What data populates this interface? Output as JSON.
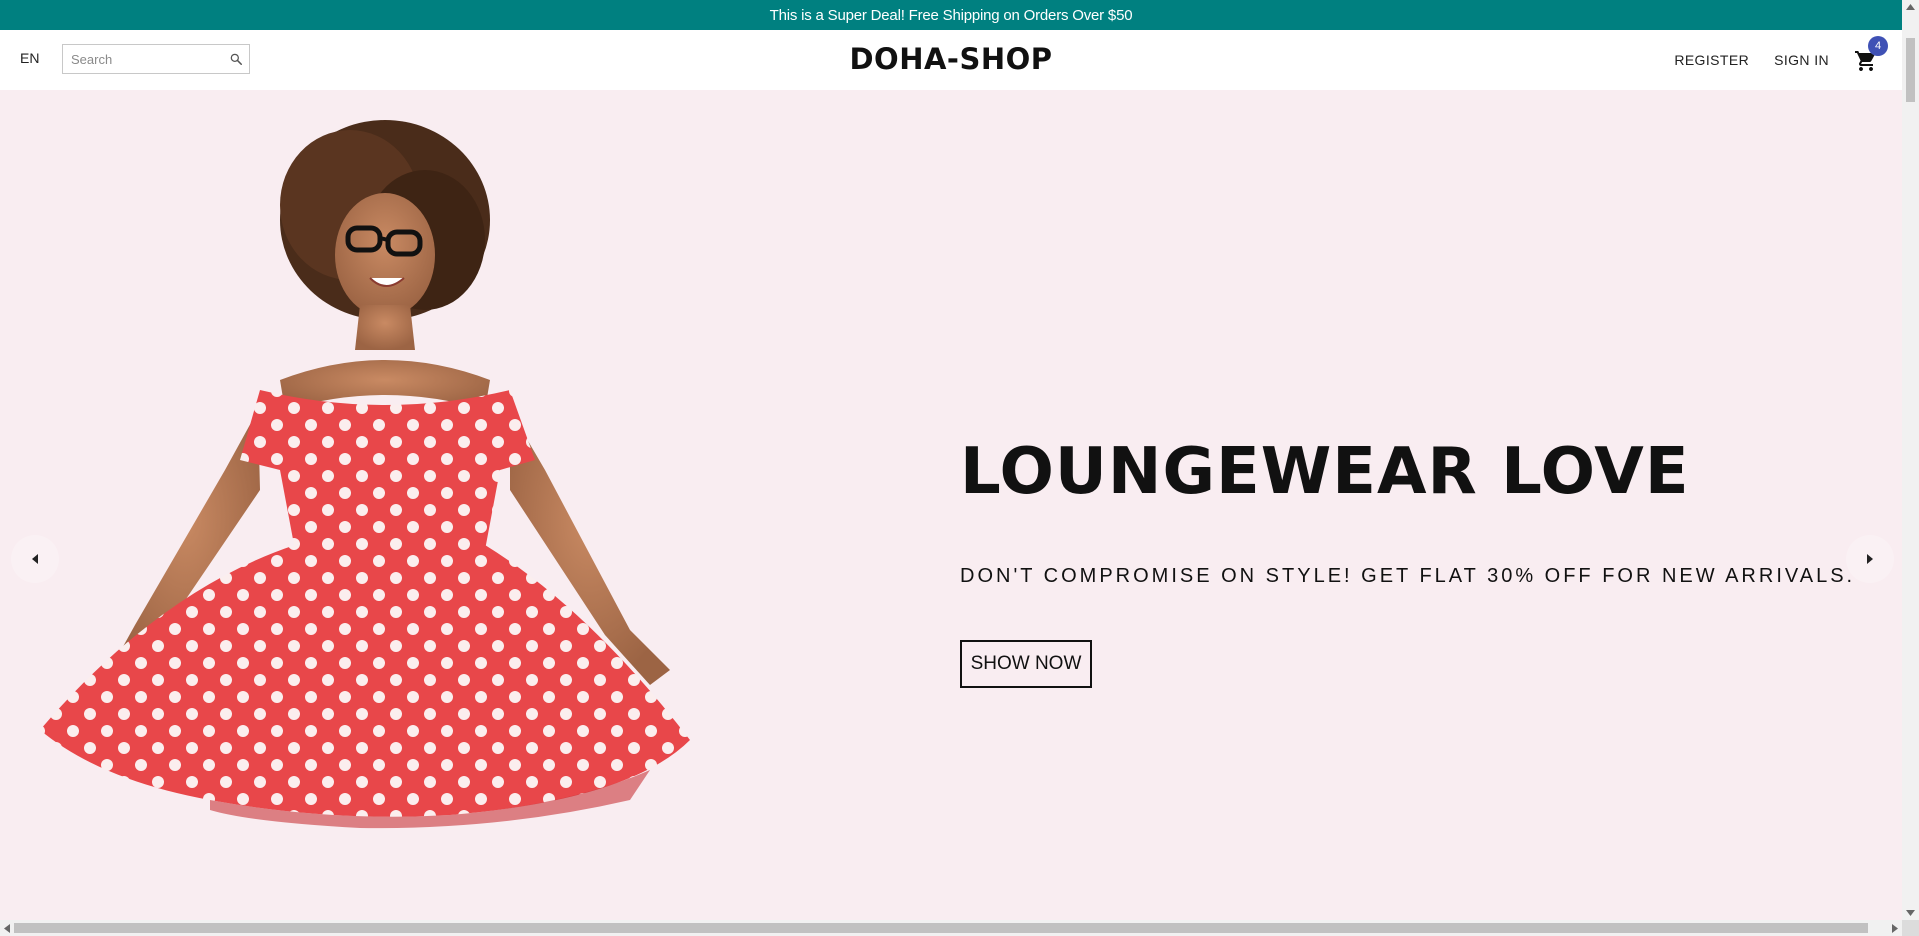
{
  "announcement": {
    "text": "This is a Super Deal! Free Shipping on Orders Over $50",
    "background": "#008080"
  },
  "header": {
    "language": "EN",
    "search": {
      "placeholder": "Search",
      "value": "",
      "icon": "search-icon"
    },
    "brand": "DOHA-SHOP",
    "register_label": "REGISTER",
    "signin_label": "SIGN IN",
    "cart": {
      "icon": "shopping-cart-icon",
      "count": "4",
      "badge_color": "#3f51b5"
    }
  },
  "hero": {
    "background": "#f9edf1",
    "title": "LOUNGEWEAR LOVE",
    "subtitle": "DON'T COMPROMISE ON STYLE! GET FLAT 30% OFF FOR NEW ARRIVALS.",
    "button_label": "SHOW NOW",
    "image": "woman-in-red-polka-dot-dress",
    "prev_icon": "caret-left-icon",
    "next_icon": "caret-right-icon"
  }
}
